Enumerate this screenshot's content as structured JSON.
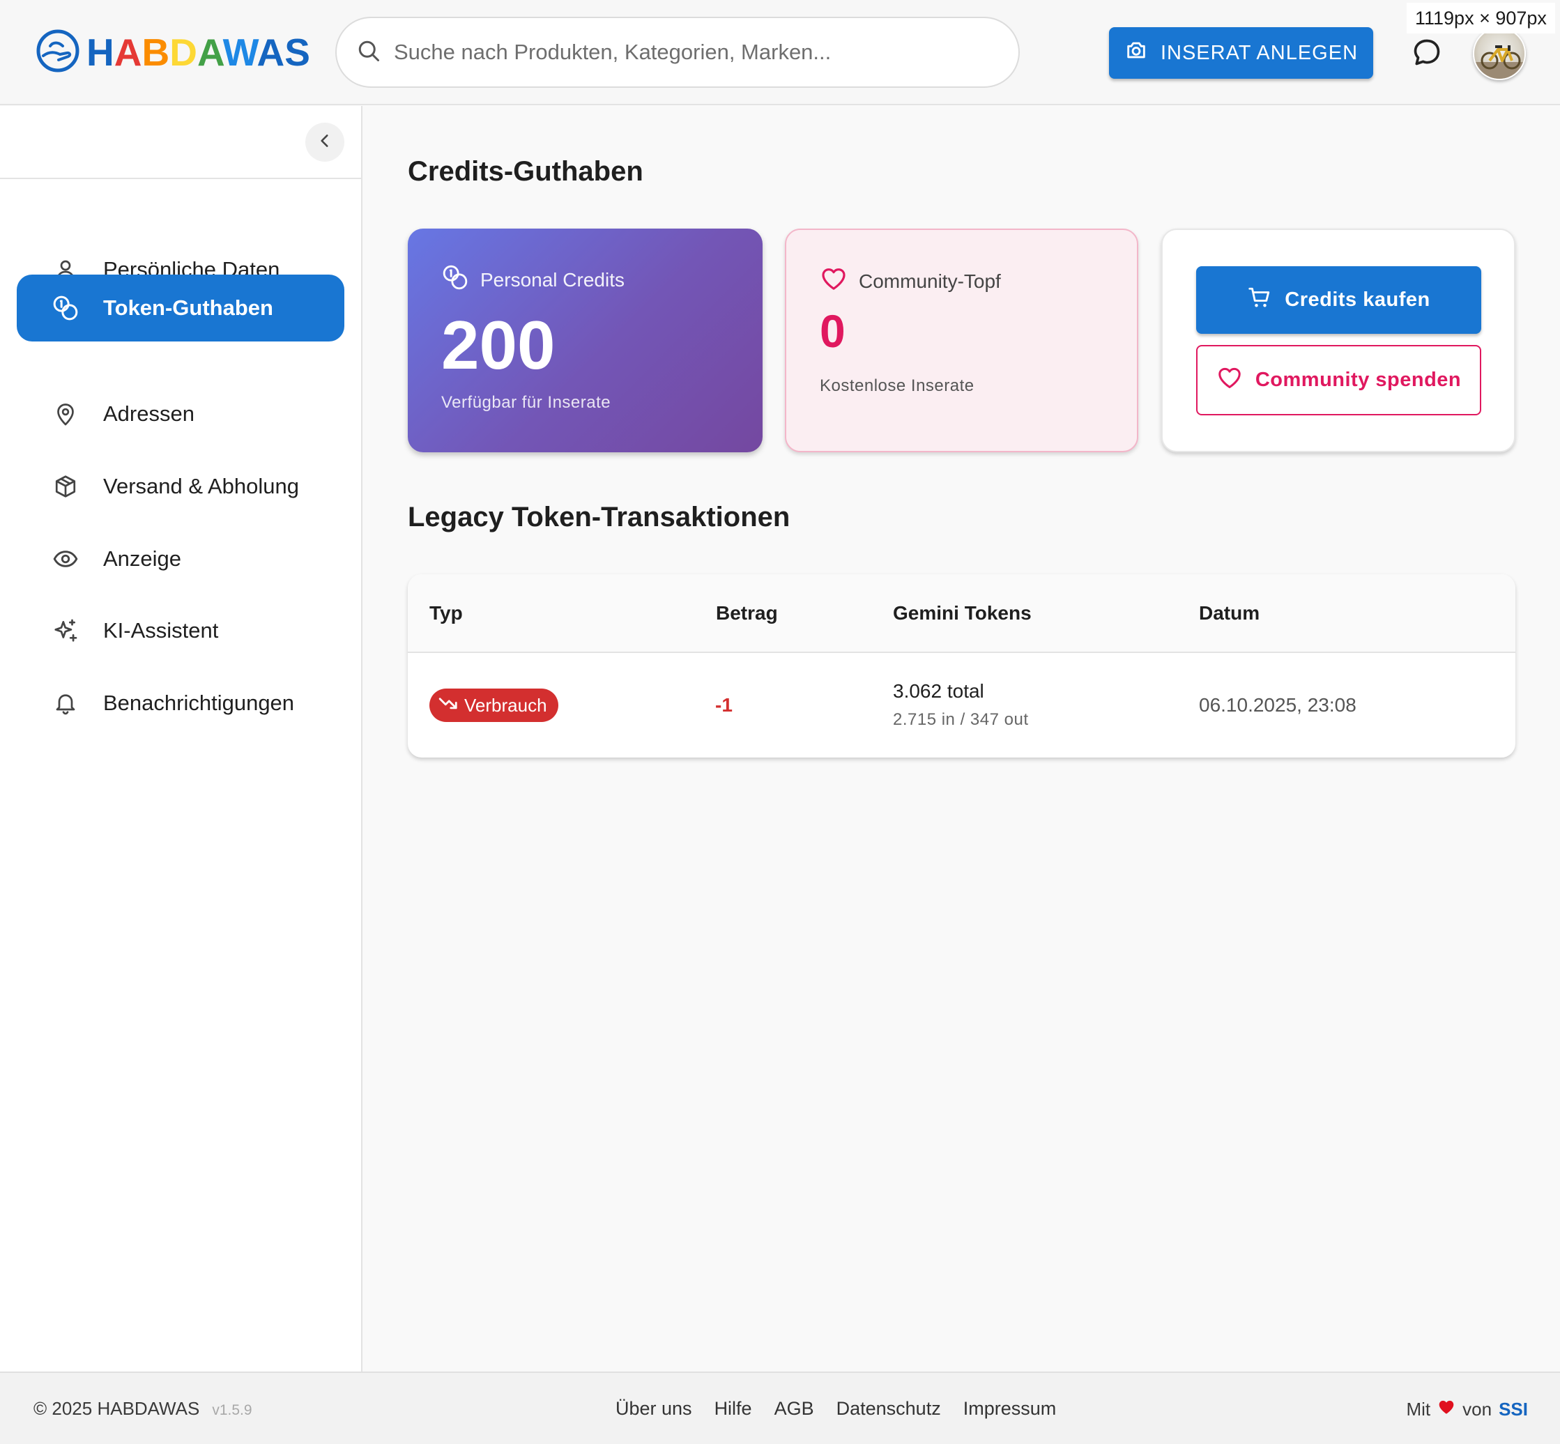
{
  "header": {
    "logo": {
      "text": "HABDAWAS",
      "letter_colors": [
        "#1565c0",
        "#e53935",
        "#fb8c00",
        "#fdd835",
        "#43a047",
        "#1e88e5",
        "#1565c0",
        "#1565c0"
      ]
    },
    "search": {
      "placeholder": "Suche nach Produkten, Kategorien, Marken..."
    },
    "cta_label": "INSERAT ANLEGEN",
    "chat_icon": "chat-bubble-icon",
    "viewport_badge": "1119px × 907px"
  },
  "sidebar": {
    "collapse_icon": "chevron-left-icon",
    "items": [
      {
        "label": "Persönliche Daten",
        "icon": "user-icon",
        "active": false
      },
      {
        "label": "Token-Guthaben",
        "icon": "coins-icon",
        "active": true
      },
      {
        "label": "Adressen",
        "icon": "map-pin-icon",
        "active": false
      },
      {
        "label": "Versand & Abholung",
        "icon": "package-icon",
        "active": false
      },
      {
        "label": "Anzeige",
        "icon": "eye-icon",
        "active": false
      },
      {
        "label": "KI-Assistent",
        "icon": "sparkles-icon",
        "active": false
      },
      {
        "label": "Benachrichtigungen",
        "icon": "bell-icon",
        "active": false
      }
    ]
  },
  "main": {
    "credits_title": "Credits-Guthaben",
    "personal": {
      "label": "Personal Credits",
      "value": "200",
      "sub": "Verfügbar für Inserate"
    },
    "community": {
      "label": "Community-Topf",
      "value": "0",
      "sub": "Kostenlose Inserate"
    },
    "actions": {
      "buy_label": "Credits kaufen",
      "donate_label": "Community spenden"
    },
    "transactions_title": "Legacy Token-Transaktionen",
    "table": {
      "columns": [
        "Typ",
        "Betrag",
        "Gemini Tokens",
        "Datum"
      ],
      "rows": [
        {
          "type": "Verbrauch",
          "amount": "-1",
          "tokens_total": "3.062 total",
          "tokens_detail": "2.715 in / 347 out",
          "date": "06.10.2025, 23:08"
        }
      ]
    }
  },
  "footer": {
    "copyright": "© 2025 HABDAWAS",
    "version": "v1.5.9",
    "links": [
      "Über uns",
      "Hilfe",
      "AGB",
      "Datenschutz",
      "Impressum"
    ],
    "made_with_prefix": "Mit",
    "made_with_suffix": "von",
    "made_by": "SSI"
  },
  "colors": {
    "primary": "#1976d2",
    "community_pink": "#e0185f",
    "consumption_red": "#d32f2f",
    "personal_gradient_start": "#6777e4",
    "personal_gradient_end": "#7448a0"
  }
}
